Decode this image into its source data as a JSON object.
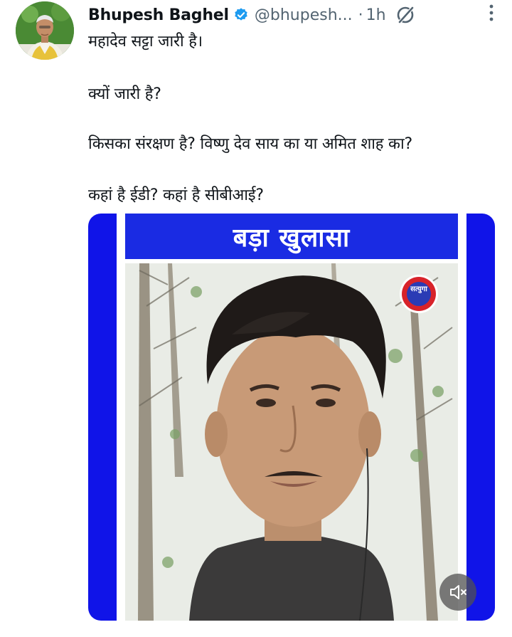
{
  "author": {
    "display_name": "Bhupesh Baghel",
    "handle": "@bhupesh...",
    "separator": "·",
    "time": "1h",
    "avatar_icon": "profile-photo",
    "verified_color": "#1d9bf0"
  },
  "post": {
    "lines": [
      "महादेव सट्टा जारी है।",
      "क्यों जारी है?",
      "किसका संरक्षण है? विष्णु देव साय का या अमित शाह का?",
      "कहां है ईडी? कहां है सीबीआई?"
    ]
  },
  "media": {
    "banner_text": "बड़ा खुलासा",
    "channel_logo_text": "सत्युगा",
    "frame_color": "#1014e8",
    "banner_color": "#1a2be3",
    "mute_icon": "speaker-muted-icon"
  }
}
